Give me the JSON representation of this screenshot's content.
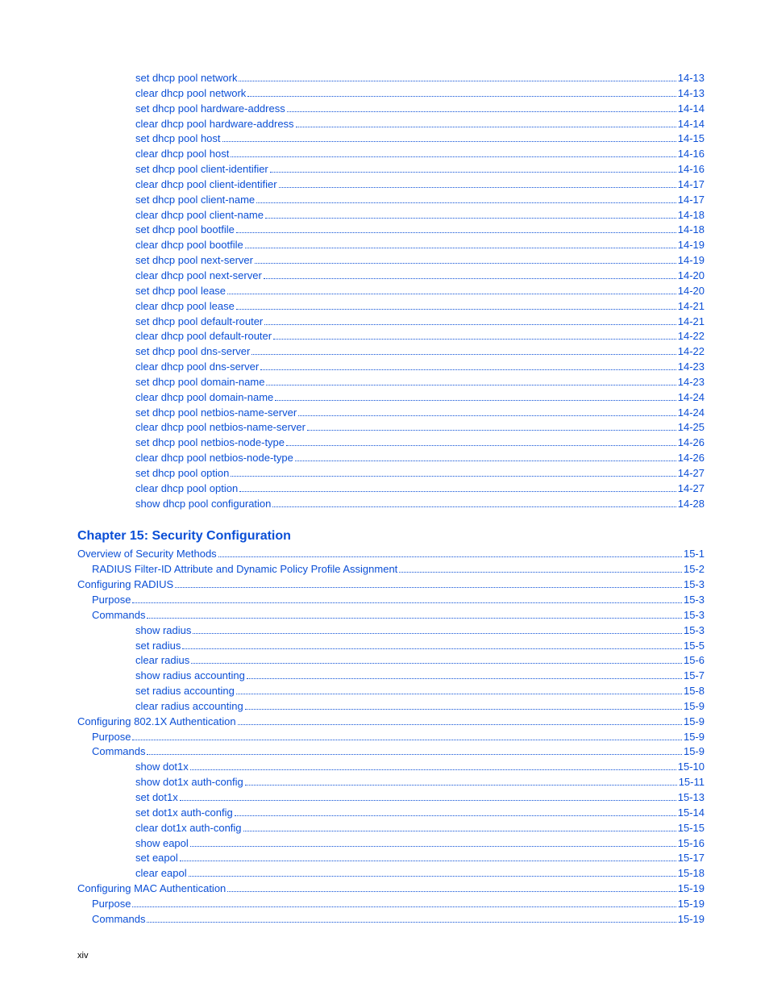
{
  "section1": [
    {
      "label": "set dhcp pool network",
      "page": "14-13",
      "indent": 3
    },
    {
      "label": "clear dhcp pool network",
      "page": "14-13",
      "indent": 3
    },
    {
      "label": "set dhcp pool hardware-address",
      "page": "14-14",
      "indent": 3
    },
    {
      "label": "clear dhcp pool hardware-address",
      "page": "14-14",
      "indent": 3
    },
    {
      "label": "set dhcp pool host",
      "page": "14-15",
      "indent": 3
    },
    {
      "label": "clear dhcp pool host",
      "page": "14-16",
      "indent": 3
    },
    {
      "label": "set dhcp pool client-identifier",
      "page": "14-16",
      "indent": 3
    },
    {
      "label": "clear dhcp pool client-identifier",
      "page": "14-17",
      "indent": 3
    },
    {
      "label": "set dhcp pool client-name",
      "page": "14-17",
      "indent": 3
    },
    {
      "label": "clear dhcp pool client-name",
      "page": "14-18",
      "indent": 3
    },
    {
      "label": "set dhcp pool bootfile",
      "page": "14-18",
      "indent": 3
    },
    {
      "label": "clear dhcp pool bootfile",
      "page": "14-19",
      "indent": 3
    },
    {
      "label": "set dhcp pool next-server",
      "page": "14-19",
      "indent": 3
    },
    {
      "label": "clear dhcp pool next-server",
      "page": "14-20",
      "indent": 3
    },
    {
      "label": "set dhcp pool lease",
      "page": "14-20",
      "indent": 3
    },
    {
      "label": "clear dhcp pool lease",
      "page": "14-21",
      "indent": 3
    },
    {
      "label": "set dhcp pool default-router",
      "page": "14-21",
      "indent": 3
    },
    {
      "label": "clear dhcp pool default-router",
      "page": "14-22",
      "indent": 3
    },
    {
      "label": "set dhcp pool dns-server",
      "page": "14-22",
      "indent": 3
    },
    {
      "label": "clear dhcp pool dns-server",
      "page": "14-23",
      "indent": 3
    },
    {
      "label": "set dhcp pool domain-name",
      "page": "14-23",
      "indent": 3
    },
    {
      "label": "clear dhcp pool domain-name",
      "page": "14-24",
      "indent": 3
    },
    {
      "label": "set dhcp pool netbios-name-server",
      "page": "14-24",
      "indent": 3
    },
    {
      "label": "clear dhcp pool netbios-name-server",
      "page": "14-25",
      "indent": 3
    },
    {
      "label": "set dhcp pool netbios-node-type",
      "page": "14-26",
      "indent": 3
    },
    {
      "label": "clear dhcp pool netbios-node-type",
      "page": "14-26",
      "indent": 3
    },
    {
      "label": "set dhcp pool option",
      "page": "14-27",
      "indent": 3
    },
    {
      "label": "clear dhcp pool option",
      "page": "14-27",
      "indent": 3
    },
    {
      "label": "show dhcp pool configuration",
      "page": "14-28",
      "indent": 3
    }
  ],
  "chapter15_title": "Chapter 15: Security Configuration",
  "section2": [
    {
      "label": "Overview of Security Methods",
      "page": "15-1",
      "indent": 0
    },
    {
      "label": "RADIUS Filter-ID Attribute and Dynamic Policy Profile Assignment",
      "page": "15-2",
      "indent": 1
    },
    {
      "label": "Configuring RADIUS",
      "page": "15-3",
      "indent": 0
    },
    {
      "label": "Purpose",
      "page": "15-3",
      "indent": 1
    },
    {
      "label": "Commands",
      "page": "15-3",
      "indent": 1
    },
    {
      "label": "show radius",
      "page": "15-3",
      "indent": 3
    },
    {
      "label": "set radius",
      "page": "15-5",
      "indent": 3
    },
    {
      "label": "clear radius",
      "page": "15-6",
      "indent": 3
    },
    {
      "label": "show radius accounting",
      "page": "15-7",
      "indent": 3
    },
    {
      "label": "set radius accounting",
      "page": "15-8",
      "indent": 3
    },
    {
      "label": "clear radius accounting",
      "page": "15-9",
      "indent": 3
    },
    {
      "label": "Configuring 802.1X Authentication",
      "page": "15-9",
      "indent": 0
    },
    {
      "label": "Purpose",
      "page": "15-9",
      "indent": 1
    },
    {
      "label": "Commands",
      "page": "15-9",
      "indent": 1
    },
    {
      "label": "show dot1x",
      "page": "15-10",
      "indent": 3
    },
    {
      "label": "show dot1x auth-config",
      "page": "15-11",
      "indent": 3
    },
    {
      "label": "set dot1x",
      "page": "15-13",
      "indent": 3
    },
    {
      "label": "set dot1x auth-config",
      "page": "15-14",
      "indent": 3
    },
    {
      "label": "clear dot1x auth-config",
      "page": "15-15",
      "indent": 3
    },
    {
      "label": "show eapol",
      "page": "15-16",
      "indent": 3
    },
    {
      "label": "set eapol",
      "page": "15-17",
      "indent": 3
    },
    {
      "label": "clear eapol",
      "page": "15-18",
      "indent": 3
    },
    {
      "label": "Configuring MAC Authentication",
      "page": "15-19",
      "indent": 0
    },
    {
      "label": "Purpose",
      "page": "15-19",
      "indent": 1
    },
    {
      "label": "Commands",
      "page": "15-19",
      "indent": 1
    }
  ],
  "page_number": "xiv"
}
